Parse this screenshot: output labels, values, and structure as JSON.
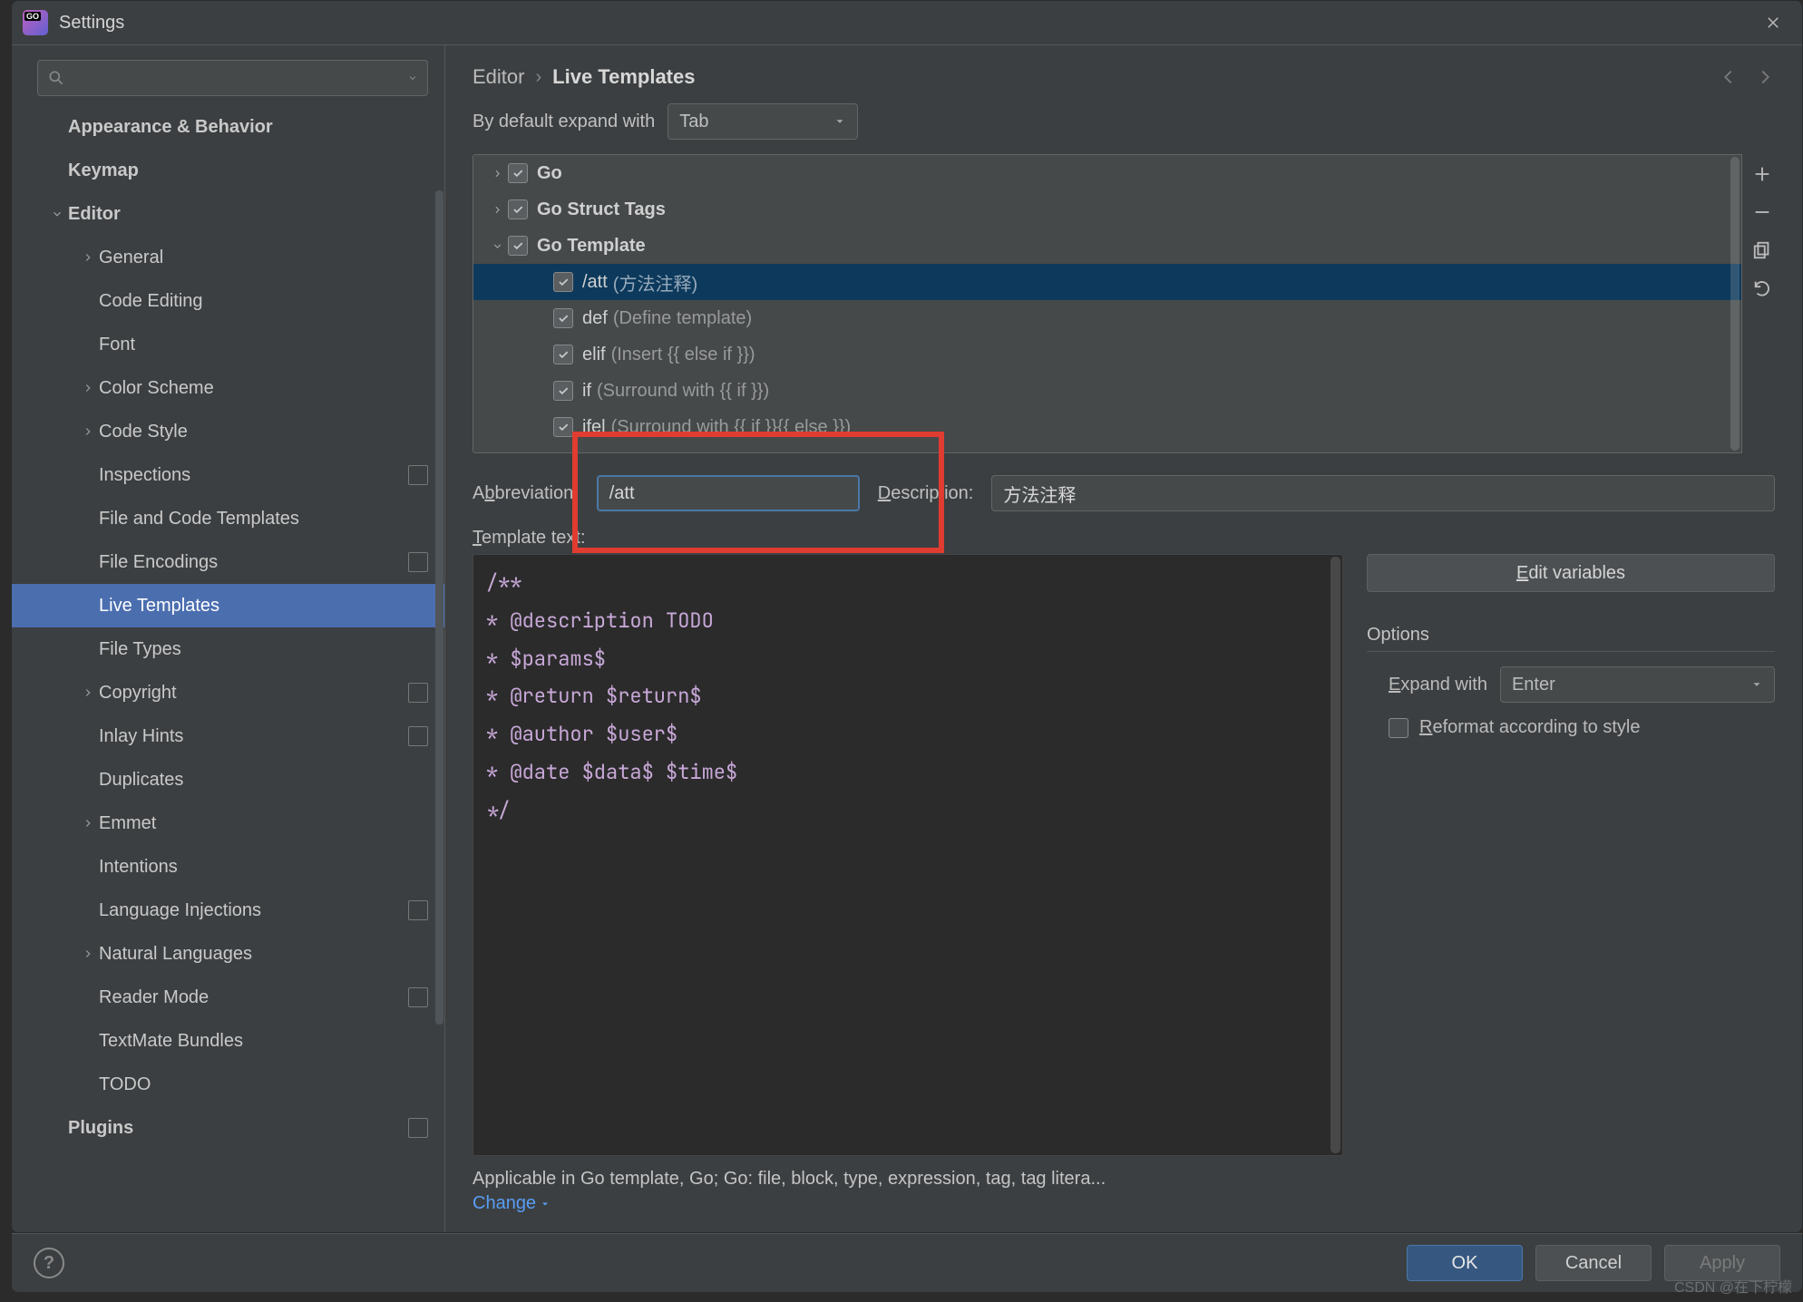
{
  "window": {
    "title": "Settings"
  },
  "sidebar": {
    "search_placeholder": "",
    "items": [
      {
        "label": "Appearance & Behavior",
        "bold": true,
        "depth": 0,
        "chev": ""
      },
      {
        "label": "Keymap",
        "bold": true,
        "depth": 0,
        "chev": ""
      },
      {
        "label": "Editor",
        "bold": true,
        "depth": 0,
        "chev": "down"
      },
      {
        "label": "General",
        "depth": 1,
        "chev": "right"
      },
      {
        "label": "Code Editing",
        "depth": 1,
        "chev": ""
      },
      {
        "label": "Font",
        "depth": 1,
        "chev": ""
      },
      {
        "label": "Color Scheme",
        "depth": 1,
        "chev": "right"
      },
      {
        "label": "Code Style",
        "depth": 1,
        "chev": "right"
      },
      {
        "label": "Inspections",
        "depth": 1,
        "chev": "",
        "proj": true
      },
      {
        "label": "File and Code Templates",
        "depth": 1,
        "chev": ""
      },
      {
        "label": "File Encodings",
        "depth": 1,
        "chev": "",
        "proj": true
      },
      {
        "label": "Live Templates",
        "depth": 1,
        "chev": "",
        "selected": true
      },
      {
        "label": "File Types",
        "depth": 1,
        "chev": ""
      },
      {
        "label": "Copyright",
        "depth": 1,
        "chev": "right",
        "proj": true
      },
      {
        "label": "Inlay Hints",
        "depth": 1,
        "chev": "",
        "proj": true
      },
      {
        "label": "Duplicates",
        "depth": 1,
        "chev": ""
      },
      {
        "label": "Emmet",
        "depth": 1,
        "chev": "right"
      },
      {
        "label": "Intentions",
        "depth": 1,
        "chev": ""
      },
      {
        "label": "Language Injections",
        "depth": 1,
        "chev": "",
        "proj": true
      },
      {
        "label": "Natural Languages",
        "depth": 1,
        "chev": "right"
      },
      {
        "label": "Reader Mode",
        "depth": 1,
        "chev": "",
        "proj": true
      },
      {
        "label": "TextMate Bundles",
        "depth": 1,
        "chev": ""
      },
      {
        "label": "TODO",
        "depth": 1,
        "chev": ""
      },
      {
        "label": "Plugins",
        "bold": true,
        "depth": 0,
        "chev": "",
        "proj": true
      }
    ]
  },
  "breadcrumb": {
    "root": "Editor",
    "leaf": "Live Templates"
  },
  "expand": {
    "label": "By default expand with",
    "value": "Tab"
  },
  "templates": [
    {
      "label": "Go",
      "bold": true,
      "chev": "right",
      "depth": 0
    },
    {
      "label": "Go Struct Tags",
      "bold": true,
      "chev": "right",
      "depth": 0
    },
    {
      "label": "Go Template",
      "bold": true,
      "chev": "down",
      "depth": 0
    },
    {
      "label": "/att",
      "hint": "(方法注释)",
      "depth": 1,
      "sel": true
    },
    {
      "label": "def",
      "hint": "(Define template)",
      "depth": 1
    },
    {
      "label": "elif",
      "hint": "(Insert {{ else if }})",
      "depth": 1
    },
    {
      "label": "if",
      "hint": "(Surround with {{ if }})",
      "depth": 1
    },
    {
      "label": "ifel",
      "hint": "(Surround with {{ if }}{{ else }})",
      "depth": 1
    }
  ],
  "form": {
    "abbr_label": "Abbreviation:",
    "abbr_value": "/att",
    "desc_label": "Description:",
    "desc_value": "方法注释",
    "tt_label": "Template text:"
  },
  "template_text": "/**\n* @description TODO\n* $params$\n* @return $return$\n* @author $user$\n* @date $data$ $time$\n*/",
  "options": {
    "edit_vars": "Edit variables",
    "title": "Options",
    "expand_label": "Expand with",
    "expand_value": "Enter",
    "reformat": "Reformat according to style"
  },
  "applicable": "Applicable in Go template, Go; Go: file, block, type, expression, tag, tag litera...",
  "change": "Change",
  "footer": {
    "ok": "OK",
    "cancel": "Cancel",
    "apply": "Apply"
  },
  "watermark": "CSDN @在下柠檬"
}
